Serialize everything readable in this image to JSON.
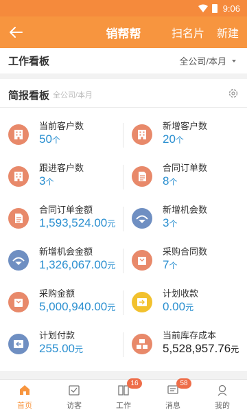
{
  "status": {
    "time": "9:06"
  },
  "appbar": {
    "title": "销帮帮",
    "scan_label": "扫名片",
    "new_label": "新建"
  },
  "workbar": {
    "label": "工作看板",
    "filter": "全公司/本月"
  },
  "brief": {
    "label": "简报看板",
    "sub": "全公司/本月"
  },
  "stats": [
    {
      "name": "当前客户数",
      "value": "50",
      "unit": "个",
      "color": "#e8896a"
    },
    {
      "name": "新增客户数",
      "value": "20",
      "unit": "个",
      "color": "#e8896a"
    },
    {
      "name": "跟进客户数",
      "value": "3",
      "unit": "个",
      "color": "#e8896a"
    },
    {
      "name": "合同订单数",
      "value": "8",
      "unit": "个",
      "color": "#e8896a"
    },
    {
      "name": "合同订单金额",
      "value": "1,593,524.00",
      "unit": "元",
      "color": "#e8896a"
    },
    {
      "name": "新增机会数",
      "value": "3",
      "unit": "个",
      "color": "#6f8fc2"
    },
    {
      "name": "新增机会金额",
      "value": "1,326,067.00",
      "unit": "元",
      "color": "#6f8fc2"
    },
    {
      "name": "采购合同数",
      "value": "7",
      "unit": "个",
      "color": "#e8896a"
    },
    {
      "name": "采购金额",
      "value": "5,000,940.00",
      "unit": "元",
      "color": "#e8896a"
    },
    {
      "name": "计划收款",
      "value": "0.00",
      "unit": "元",
      "color": "#f2c12e"
    },
    {
      "name": "计划付款",
      "value": "255.00",
      "unit": "元",
      "color": "#6f8fc2"
    },
    {
      "name": "当前库存成本",
      "value": "5,528,957.76",
      "unit": "元",
      "color": "#e8896a"
    }
  ],
  "tabs": [
    {
      "label": "首页",
      "icon": "home-icon",
      "badge": ""
    },
    {
      "label": "访客",
      "icon": "visitor-icon",
      "badge": ""
    },
    {
      "label": "工作",
      "icon": "work-icon",
      "badge": "16"
    },
    {
      "label": "消息",
      "icon": "message-icon",
      "badge": "58"
    },
    {
      "label": "我的",
      "icon": "profile-icon",
      "badge": ""
    }
  ],
  "colors": {
    "accent": "#f7953f",
    "value_blue": "#2a8fd0"
  }
}
